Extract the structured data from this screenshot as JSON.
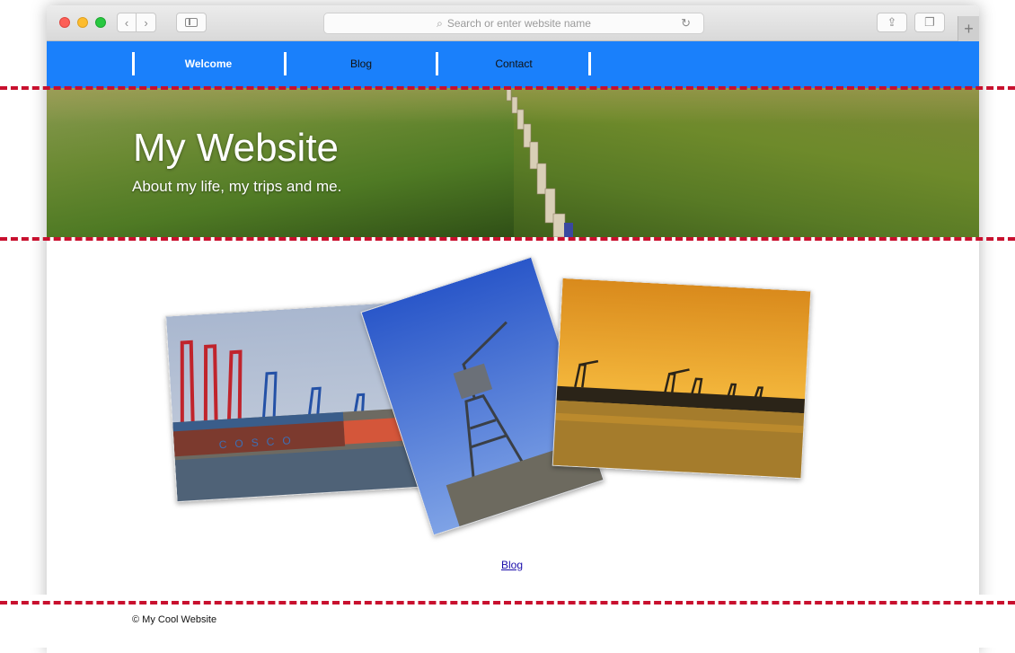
{
  "browser": {
    "url_placeholder": "Search or enter website name",
    "icons": {
      "back": "‹",
      "forward": "›",
      "search": "⌕",
      "reload": "↻",
      "share": "⇪",
      "tabs": "❐",
      "new_tab": "+"
    }
  },
  "nav": {
    "items": [
      {
        "label": "Welcome",
        "active": true
      },
      {
        "label": "Blog",
        "active": false
      },
      {
        "label": "Contact",
        "active": false
      }
    ]
  },
  "hero": {
    "title": "My Website",
    "subtitle": "About my life, my trips and me."
  },
  "main": {
    "photos": [
      "harbor-cranes-cosco-photo",
      "single-crane-photo",
      "sunset-harbor-photo"
    ],
    "link_label": "Blog"
  },
  "footer": {
    "text": "© My Cool Website"
  },
  "colors": {
    "nav_bg": "#1a80fb",
    "guide": "#c8102e"
  }
}
